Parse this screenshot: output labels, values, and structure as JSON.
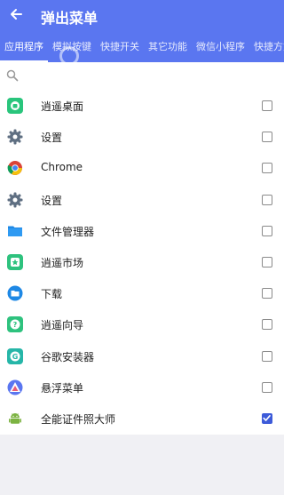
{
  "appbar": {
    "title": "弹出菜单",
    "back_icon": "arrow-left-icon"
  },
  "tabs": [
    {
      "label": "应用程序",
      "active": true
    },
    {
      "label": "模拟按键",
      "active": false
    },
    {
      "label": "快捷开关",
      "active": false
    },
    {
      "label": "其它功能",
      "active": false
    },
    {
      "label": "微信小程序",
      "active": false
    },
    {
      "label": "快捷方式",
      "active": false
    }
  ],
  "search": {
    "icon": "search-icon",
    "value": "",
    "placeholder": ""
  },
  "apps": [
    {
      "label": "逍遥桌面",
      "icon": "xiaoyao-desktop-icon",
      "checked": false
    },
    {
      "label": "设置",
      "icon": "settings-gear-icon",
      "checked": false
    },
    {
      "label": "Chrome",
      "icon": "chrome-icon",
      "checked": false
    },
    {
      "label": "设置",
      "icon": "settings-gear-icon",
      "checked": false
    },
    {
      "label": "文件管理器",
      "icon": "folder-icon",
      "checked": false
    },
    {
      "label": "逍遥市场",
      "icon": "market-icon",
      "checked": false
    },
    {
      "label": "下载",
      "icon": "download-folder-icon",
      "checked": false
    },
    {
      "label": "逍遥向导",
      "icon": "guide-icon",
      "checked": false
    },
    {
      "label": "谷歌安装器",
      "icon": "google-installer-icon",
      "checked": false
    },
    {
      "label": "悬浮菜单",
      "icon": "floating-menu-icon",
      "checked": false
    },
    {
      "label": "全能证件照大师",
      "icon": "android-icon",
      "checked": true
    }
  ],
  "colors": {
    "accent": "#5a76f0",
    "checkbox_checked": "#3d5bd9"
  }
}
